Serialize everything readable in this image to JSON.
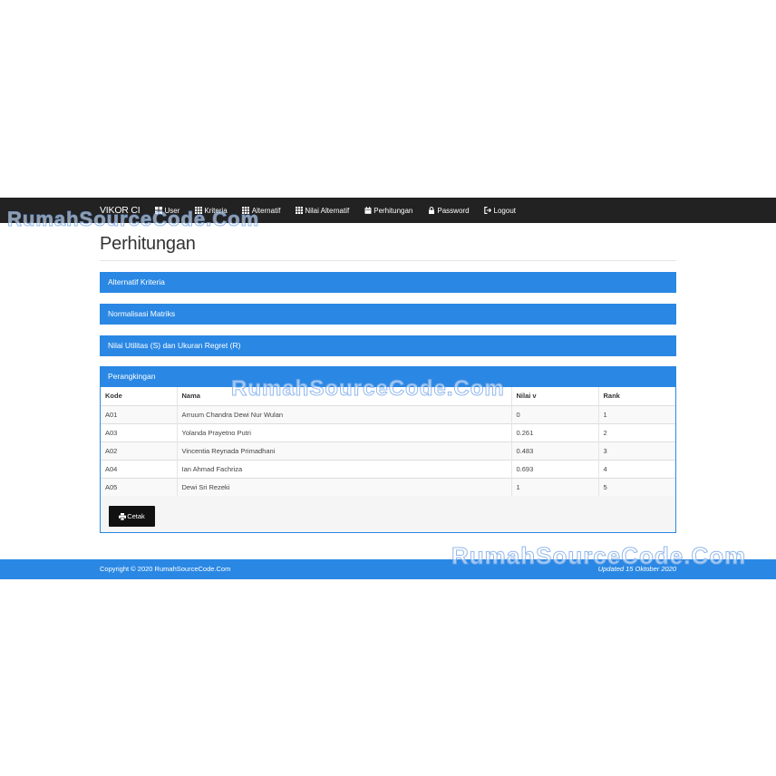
{
  "navbar": {
    "brand": "VIKOR CI",
    "items": [
      {
        "label": "User",
        "icon": "dashboard-icon"
      },
      {
        "label": "Kriteria",
        "icon": "grid-icon"
      },
      {
        "label": "Alternatif",
        "icon": "grid-icon"
      },
      {
        "label": "Nilai Alternatif",
        "icon": "grid-icon"
      },
      {
        "label": "Perhitungan",
        "icon": "calendar-icon"
      },
      {
        "label": "Password",
        "icon": "lock-icon"
      },
      {
        "label": "Logout",
        "icon": "logout-icon"
      }
    ]
  },
  "page": {
    "title": "Perhitungan"
  },
  "panels": [
    {
      "title": "Alternatif Kriteria"
    },
    {
      "title": "Normalisasi Matriks"
    },
    {
      "title": "Nilai Utilitas (S) dan Ukuran Regret (R)"
    },
    {
      "title": "Perangkingan"
    }
  ],
  "ranking": {
    "columns": [
      "Kode",
      "Nama",
      "Nilai v",
      "Rank"
    ],
    "rows": [
      [
        "A01",
        "Arruum Chandra Dewi Nur Wulan",
        "0",
        "1"
      ],
      [
        "A03",
        "Yolanda Prayetno Putri",
        "0.261",
        "2"
      ],
      [
        "A02",
        "Vincentia Reynada Primadhani",
        "0.483",
        "3"
      ],
      [
        "A04",
        "Ian Ahmad Fachriza",
        "0.693",
        "4"
      ],
      [
        "A05",
        "Dewi Sri Rezeki",
        "1",
        "5"
      ]
    ],
    "print_button": "Cetak"
  },
  "footer": {
    "copyright": "Copyright © 2020 RumahSourceCode.Com",
    "updated": "Updated 15 Oktober 2020"
  },
  "watermark": "RumahSourceCode.Com",
  "colors": {
    "navbar": "#222222",
    "accent": "#2a88e4",
    "button": "#111111"
  }
}
